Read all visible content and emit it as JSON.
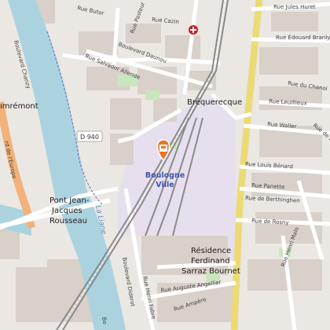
{
  "map": {
    "colors": {
      "background": "#ebe7e2",
      "water": "#aad3df",
      "rail_area": "#e8dfee",
      "park": "#c9e6bf",
      "building": "#d9d0c9",
      "main_road": "#f7e77f",
      "primary_road": "#f2b27a",
      "marker": "#e8742a",
      "station_label": "#3a56a8"
    },
    "station": {
      "name_line1": "Boulogne",
      "name_line2": "Ville",
      "marker_icon": "train-station-marker-icon"
    },
    "place_labels": {
      "brequerecque": "Bréquerecque",
      "capecure_partial": "ımrémont",
      "residence_line1": "Résidence",
      "residence_line2": "Ferdinand",
      "residence_line3": "Sarraz Bournet",
      "pont_line1": "Pont Jean-",
      "pont_line2": "Jacques",
      "pont_line3": "Rousseau",
      "river": "La Liane"
    },
    "shield": {
      "label": "D 940"
    },
    "streets": {
      "boulevard_daunou": "Boulevard Daunou",
      "rue_salvador_allende": "Rue Salvador Allende",
      "rue_cazin": "Rue Cazin",
      "rue_pasteur": "Rue Pasteur",
      "rue_butor": "Rue Butor",
      "rue_jules_huret": "Rue Jules Huret",
      "rue_edouard_branly": "Rue Édouard Branly",
      "rue_du_chanoine": "Rue du Chanoi",
      "rue_leuillieux": "Rue Leuillieux",
      "rue_waller": "Rue Waller",
      "rue_de_belle": "Rue de Belle",
      "rue_louis_benard": "Rue Louis Bénard",
      "rue_panette": "Rue Panette",
      "rue_de_berthinghen": "Rue de Berthinghen",
      "rue_de_rosny": "Rue de Rosny",
      "rue_henri_malo": "Rue Henri Malo",
      "rue_auguste_angellier": "Rue Auguste Angellier",
      "rue_ampere": "Rue Ampère",
      "rue_henri_fabre": "Rue Henri Fabre",
      "boulevard_diderot": "Boulevard Diderot",
      "boulevard_chanzy": "Boulevard Chanzy",
      "boulevard_de_leurope": "Boulevard de l'Europe",
      "bd_partial": "Bo",
      "rue_de_bretagne_partial": "rd de l'Europe"
    }
  }
}
